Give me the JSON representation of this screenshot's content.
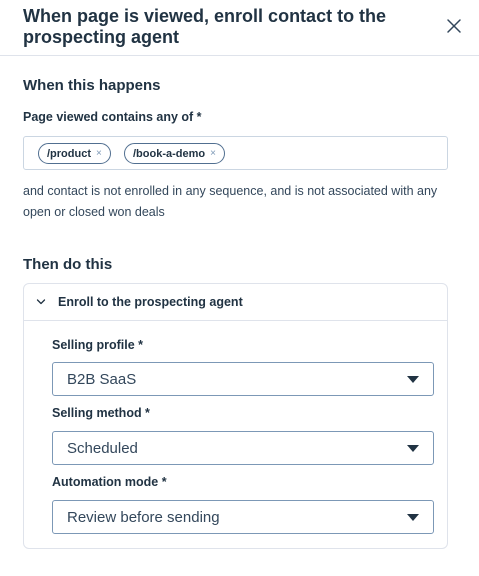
{
  "header": {
    "title": "When page is viewed, enroll contact to the prospecting agent"
  },
  "trigger": {
    "section_title": "When this happens",
    "field_label": "Page viewed contains any of *",
    "tags": [
      {
        "label": "/product",
        "remove": "×"
      },
      {
        "label": "/book-a-demo",
        "remove": "×"
      }
    ],
    "condition": "and contact is not enrolled in any sequence, and is not associated with any open or closed won deals"
  },
  "action": {
    "section_title": "Then do this",
    "card_label": "Enroll to the prospecting agent",
    "fields": [
      {
        "label": "Selling profile *",
        "value": "B2B SaaS"
      },
      {
        "label": "Selling method *",
        "value": "Scheduled"
      },
      {
        "label": "Automation mode *",
        "value": "Review before sending"
      }
    ]
  },
  "icons": {
    "close": "close-icon",
    "chevron": "chevron-down-icon",
    "caret": "caret-down-icon"
  },
  "colors": {
    "heading": "#213343",
    "text": "#33475b",
    "border": "#cbd6e2",
    "divider": "#dfe3eb"
  }
}
